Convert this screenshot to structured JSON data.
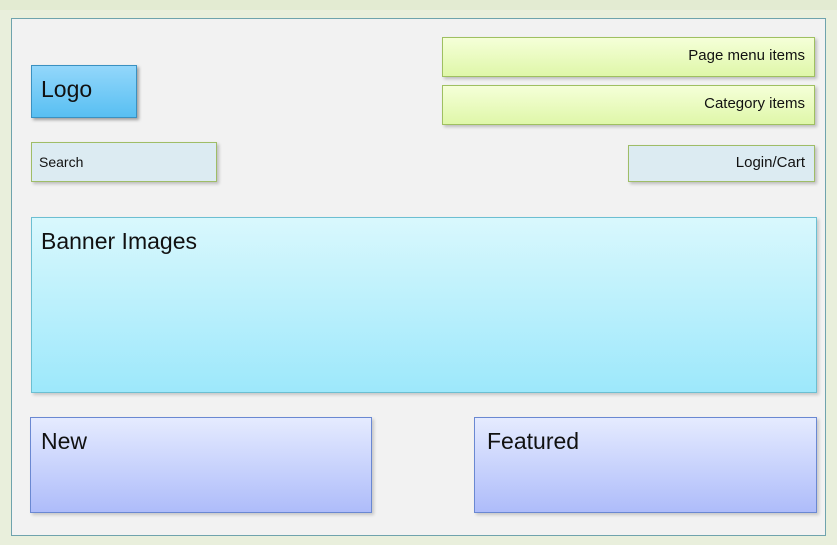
{
  "header": {
    "logo": "Logo",
    "page_menu_items": "Page menu items",
    "category_items": "Category items",
    "search": "Search",
    "login_cart": "Login/Cart"
  },
  "main": {
    "banner": "Banner Images",
    "new": "New",
    "featured": "Featured"
  }
}
